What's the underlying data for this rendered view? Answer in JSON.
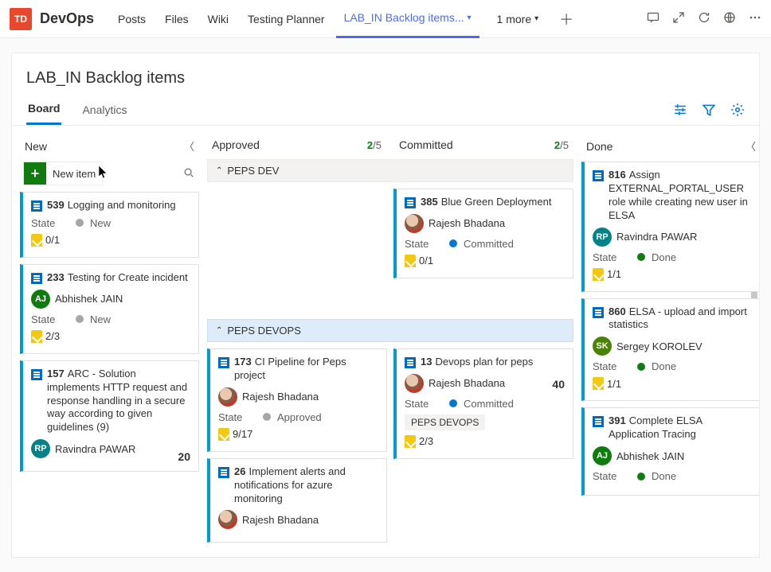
{
  "header": {
    "avatar_initials": "TD",
    "app_name": "DevOps",
    "tabs": [
      "Posts",
      "Files",
      "Wiki",
      "Testing Planner"
    ],
    "active_tab": "LAB_IN Backlog items...",
    "more_label": "1 more"
  },
  "page_title": "LAB_IN Backlog items",
  "sub_tabs": {
    "board": "Board",
    "analytics": "Analytics"
  },
  "new_item_label": "New item",
  "columns": [
    {
      "key": "new",
      "title": "New",
      "count": ""
    },
    {
      "key": "approved",
      "title": "Approved",
      "cur": "2",
      "limit": "/5"
    },
    {
      "key": "committed",
      "title": "Committed",
      "cur": "2",
      "limit": "/5"
    },
    {
      "key": "done",
      "title": "Done",
      "count": ""
    }
  ],
  "swimlanes": {
    "peps_dev": "PEPS DEV",
    "peps_devops": "PEPS DEVOPS"
  },
  "states": {
    "new": "New",
    "approved": "Approved",
    "committed": "Committed",
    "done": "Done"
  },
  "labels": {
    "state": "State"
  },
  "cards": {
    "new": [
      {
        "id": "539",
        "title": "Logging and monitoring",
        "state": "new",
        "tasks": "0/1"
      },
      {
        "id": "233",
        "title": "Testing for Create incident",
        "assignee": {
          "initials": "AJ",
          "color": "#107c10",
          "name": "Abhishek JAIN"
        },
        "state": "new",
        "tasks": "2/3"
      },
      {
        "id": "157",
        "title": "ARC - Solution implements HTTP request and response handling in a secure way according to given guidelines (9)",
        "assignee": {
          "initials": "RP",
          "color": "#038387",
          "name": "Ravindra PAWAR"
        },
        "effort": "20"
      }
    ],
    "approved_dev": [],
    "committed_dev": [
      {
        "id": "385",
        "title": "Blue Green Deployment",
        "assignee": {
          "img": true,
          "name": "Rajesh Bhadana"
        },
        "state": "committed",
        "tasks": "0/1"
      }
    ],
    "approved_devops": [
      {
        "id": "173",
        "title": "CI Pipeline for Peps project",
        "assignee": {
          "img": true,
          "name": "Rajesh Bhadana"
        },
        "state": "approved",
        "tasks": "9/17"
      },
      {
        "id": "26",
        "title": "Implement alerts and notifications for azure monitoring",
        "assignee": {
          "img": true,
          "name": "Rajesh Bhadana"
        }
      }
    ],
    "committed_devops": [
      {
        "id": "13",
        "title": "Devops plan for peps",
        "assignee": {
          "img": true,
          "name": "Rajesh Bhadana"
        },
        "state": "committed",
        "effort": "40",
        "tag": "PEPS DEVOPS",
        "tasks": "2/3"
      }
    ],
    "done": [
      {
        "id": "816",
        "title": "Assign EXTERNAL_PORTAL_USER role while creating new user in ELSA",
        "assignee": {
          "initials": "RP",
          "color": "#038387",
          "name": "Ravindra PAWAR"
        },
        "state": "done",
        "tasks": "1/1"
      },
      {
        "id": "860",
        "title": "ELSA - upload and import statistics",
        "assignee": {
          "initials": "SK",
          "color": "#498205",
          "name": "Sergey KOROLEV"
        },
        "state": "done",
        "tasks": "1/1"
      },
      {
        "id": "391",
        "title": "Complete ELSA Application Tracing",
        "assignee": {
          "initials": "AJ",
          "color": "#107c10",
          "name": "Abhishek JAIN"
        },
        "state": "done"
      }
    ]
  }
}
